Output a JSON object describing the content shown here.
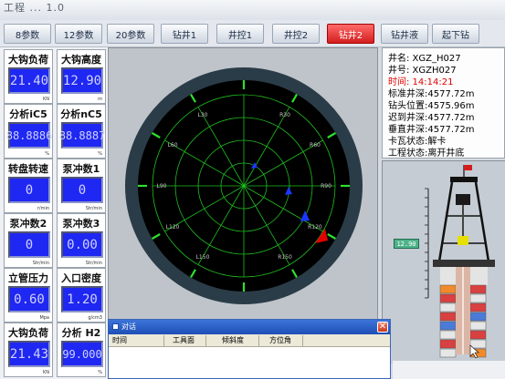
{
  "window": {
    "title": "工程 ... 1.0"
  },
  "tabs": [
    {
      "label": "8参数",
      "active": false
    },
    {
      "label": "12参数",
      "active": false
    },
    {
      "label": "20参数",
      "active": false
    },
    {
      "label": "钻井1",
      "active": false
    },
    {
      "label": "井控1",
      "active": false
    },
    {
      "label": "井控2",
      "active": false
    },
    {
      "label": "钻井2",
      "active": true
    },
    {
      "label": "钻井液",
      "active": false
    },
    {
      "label": "起下钻",
      "active": false
    }
  ],
  "gauges": [
    {
      "label": "大钩负荷",
      "value": "21.40",
      "unit": "KN"
    },
    {
      "label": "大钩高度",
      "value": "12.90",
      "unit": "m"
    },
    {
      "label": "分析iC5",
      "value": "88.8886",
      "unit": "%"
    },
    {
      "label": "分析nC5",
      "value": "88.8887",
      "unit": "%"
    },
    {
      "label": "转盘转速",
      "value": "0",
      "unit": "r/min"
    },
    {
      "label": "泵冲数1",
      "value": "0",
      "unit": "Str/min"
    },
    {
      "label": "泵冲数2",
      "value": "0",
      "unit": "Str/min"
    },
    {
      "label": "泵冲数3",
      "value": "0.00",
      "unit": "Str/min"
    },
    {
      "label": "立管压力",
      "value": "0.60",
      "unit": "Mpa"
    },
    {
      "label": "入口密度",
      "value": "1.20",
      "unit": "g/cm3"
    },
    {
      "label": "大钩负荷",
      "value": "21.43",
      "unit": "KN"
    },
    {
      "label": "分析 H2",
      "value": "99.000",
      "unit": "%"
    }
  ],
  "radar": {
    "labels": [
      "L30",
      "R30",
      "L60",
      "R60",
      "L90",
      "R90",
      "L120",
      "R120",
      "L150",
      "R150"
    ],
    "ring_color": "#2a3c47",
    "grid_color": "#1fbf1f",
    "marker_color": "#1a37ff",
    "alert_color": "#e00000"
  },
  "info": {
    "well_name": "井名: XGZ_H027",
    "well_no": "井号: XGZH027",
    "time": "时间: 14:14:21",
    "std_depth": "标准井深:4577.72m",
    "bit_pos": "钻头位置:4575.96m",
    "lag_depth": "迟到井深:4577.72m",
    "vert_depth": "垂直井深:4577.72m",
    "slip_state": "卡瓦状态:解卡",
    "work_state": "工程状态:离开井底"
  },
  "rig": {
    "readout": "12.90",
    "flag_color": "#d31e1e"
  },
  "dialog": {
    "title": "对话",
    "close": "✕",
    "columns": [
      "时间",
      "工具面",
      "倾斜度",
      "方位角"
    ]
  }
}
